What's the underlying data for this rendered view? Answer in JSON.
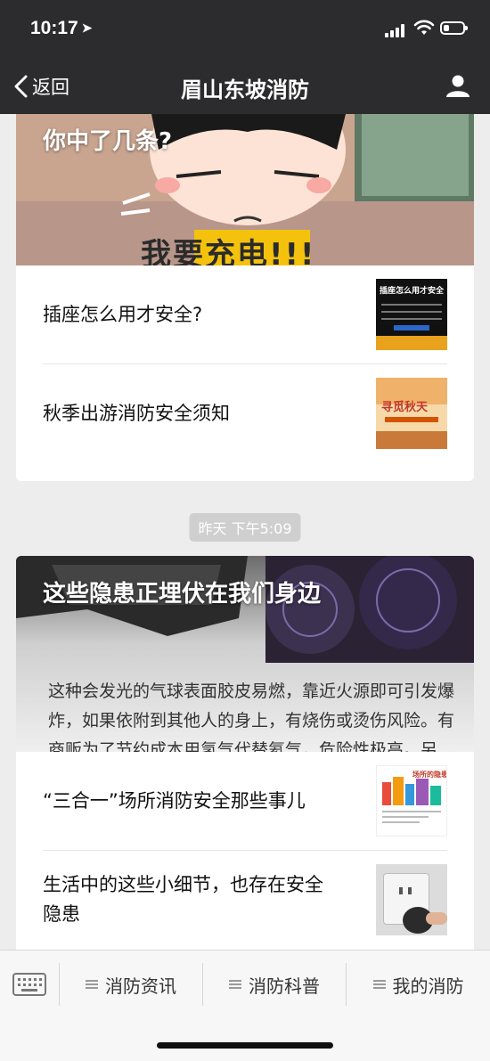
{
  "status": {
    "time": "10:17",
    "location_arrow": "➤"
  },
  "nav": {
    "back_label": "返回",
    "title": "眉山东坡消防"
  },
  "card1": {
    "cover_title": "你中了几条?",
    "cover_caption": "我要充电!!!",
    "items": [
      {
        "title": "插座怎么用才安全?",
        "thumb_text": "插座怎么用才安全?"
      },
      {
        "title": "秋季出游消防安全须知",
        "thumb_text": "寻觅秋天"
      }
    ]
  },
  "timestamp": "昨天 下午5:09",
  "card2": {
    "cover_title": "这些隐患正埋伏在我们身边",
    "cover_body": "这种会发光的气球表面胶皮易燃，靠近火源即可引发爆炸，如果依附到其他人的身上，有烧伤或烫伤风险。有商贩为了节约成本用氢气代替氦气，危险性极高。另",
    "items": [
      {
        "title": "“三合一”场所消防安全那些事儿",
        "thumb_text": "场所的隐患"
      },
      {
        "title": "生活中的这些小细节，也存在安全隐患"
      }
    ]
  },
  "menu": {
    "buttons": [
      {
        "label": "消防资讯"
      },
      {
        "label": "消防科普"
      },
      {
        "label": "我的消防"
      }
    ]
  },
  "colors": {
    "nav_bg": "#2c2c2e",
    "page_bg": "#ededed",
    "menu_bg": "#f7f7f7"
  }
}
